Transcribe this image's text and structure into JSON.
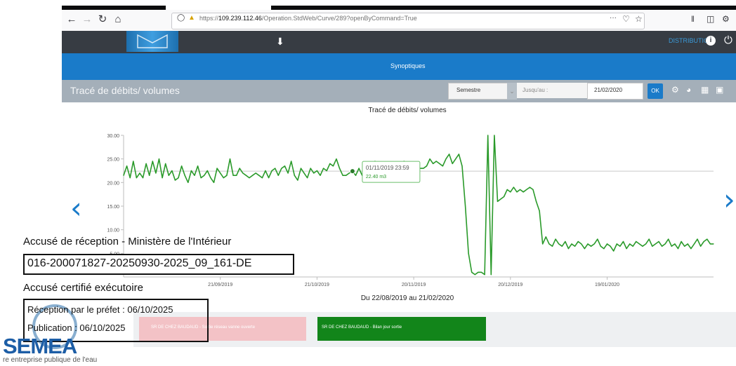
{
  "browser": {
    "url_prefix": "https://",
    "url_host": "109.239.112.46",
    "url_path": "/Operation.StdWeb/Curve/289?openByCommand=True",
    "menu_label": "···"
  },
  "header": {
    "distribution_label": "DISTRIBUTION"
  },
  "nav": {
    "synoptiques_label": "Synoptiques"
  },
  "toolbar": {
    "title": "Tracé de débits/ volumes",
    "period_value": "Semestre",
    "until_label": "Jusqu'au :",
    "date_value": "21/02/2020",
    "ok_label": "OK"
  },
  "chart": {
    "title": "Tracé de débits/ volumes",
    "period_label": "Du 22/08/2019 au 21/02/2020",
    "tooltip_date": "01/11/2019 23:59",
    "tooltip_value": "22.40 m3"
  },
  "chart_data": {
    "type": "line",
    "title": "Tracé de débits/ volumes",
    "xlabel": "Du 22/08/2019 au 21/02/2020",
    "ylabel": "",
    "x_range": [
      "2019-08-22",
      "2020-02-21"
    ],
    "ylim": [
      0,
      30
    ],
    "y_ticks": [
      5,
      10,
      15,
      20,
      25,
      30
    ],
    "y_tick_labels": [
      "5.00",
      "10.00",
      "15.00",
      "20.00",
      "25.00",
      "30.00"
    ],
    "x_tick_labels": [
      "21/09/2019",
      "21/10/2019",
      "20/11/2019",
      "20/12/2019",
      "19/01/2020"
    ],
    "x_tick_dates": [
      "2019-09-21",
      "2019-10-21",
      "2019-11-20",
      "2019-12-20",
      "2020-01-19"
    ],
    "grid": false,
    "reference_line": 22.4,
    "series": [
      {
        "color": "#2a9a2a",
        "points": [
          [
            "2019-08-22",
            21.5
          ],
          [
            "2019-08-23",
            23.5
          ],
          [
            "2019-08-24",
            21.0
          ],
          [
            "2019-08-25",
            24.5
          ],
          [
            "2019-08-26",
            21.0
          ],
          [
            "2019-08-27",
            22.0
          ],
          [
            "2019-08-28",
            21.0
          ],
          [
            "2019-08-29",
            24.0
          ],
          [
            "2019-08-30",
            21.5
          ],
          [
            "2019-08-31",
            24.5
          ],
          [
            "2019-09-01",
            22.0
          ],
          [
            "2019-09-02",
            25.0
          ],
          [
            "2019-09-03",
            21.0
          ],
          [
            "2019-09-04",
            24.0
          ],
          [
            "2019-09-05",
            21.5
          ],
          [
            "2019-09-06",
            22.5
          ],
          [
            "2019-09-07",
            20.5
          ],
          [
            "2019-09-08",
            21.0
          ],
          [
            "2019-09-09",
            23.5
          ],
          [
            "2019-09-10",
            21.5
          ],
          [
            "2019-09-11",
            20.0
          ],
          [
            "2019-09-12",
            22.5
          ],
          [
            "2019-09-13",
            21.5
          ],
          [
            "2019-09-14",
            23.5
          ],
          [
            "2019-09-15",
            21.0
          ],
          [
            "2019-09-16",
            21.5
          ],
          [
            "2019-09-17",
            22.5
          ],
          [
            "2019-09-18",
            21.0
          ],
          [
            "2019-09-19",
            20.0
          ],
          [
            "2019-09-20",
            23.0
          ],
          [
            "2019-09-21",
            22.0
          ],
          [
            "2019-09-22",
            21.0
          ],
          [
            "2019-09-23",
            21.5
          ],
          [
            "2019-09-24",
            25.0
          ],
          [
            "2019-09-25",
            21.5
          ],
          [
            "2019-09-26",
            21.5
          ],
          [
            "2019-09-27",
            23.0
          ],
          [
            "2019-09-28",
            22.0
          ],
          [
            "2019-09-29",
            21.5
          ],
          [
            "2019-09-30",
            21.0
          ],
          [
            "2019-10-01",
            21.5
          ],
          [
            "2019-10-02",
            22.0
          ],
          [
            "2019-10-03",
            21.5
          ],
          [
            "2019-10-04",
            21.0
          ],
          [
            "2019-10-05",
            22.5
          ],
          [
            "2019-10-06",
            21.0
          ],
          [
            "2019-10-07",
            22.5
          ],
          [
            "2019-10-08",
            23.0
          ],
          [
            "2019-10-09",
            21.5
          ],
          [
            "2019-10-10",
            23.0
          ],
          [
            "2019-10-11",
            23.5
          ],
          [
            "2019-10-12",
            22.0
          ],
          [
            "2019-10-13",
            24.5
          ],
          [
            "2019-10-14",
            21.5
          ],
          [
            "2019-10-15",
            20.5
          ],
          [
            "2019-10-16",
            23.0
          ],
          [
            "2019-10-17",
            22.0
          ],
          [
            "2019-10-18",
            21.0
          ],
          [
            "2019-10-19",
            23.0
          ],
          [
            "2019-10-20",
            22.0
          ],
          [
            "2019-10-21",
            22.5
          ],
          [
            "2019-10-22",
            21.5
          ],
          [
            "2019-10-23",
            23.0
          ],
          [
            "2019-10-24",
            22.5
          ],
          [
            "2019-10-25",
            24.0
          ],
          [
            "2019-10-26",
            23.5
          ],
          [
            "2019-10-27",
            25.0
          ],
          [
            "2019-10-28",
            23.0
          ],
          [
            "2019-10-29",
            21.5
          ],
          [
            "2019-10-30",
            21.5
          ],
          [
            "2019-10-31",
            22.0
          ],
          [
            "2019-11-01",
            22.4
          ],
          [
            "2019-11-02",
            21.5
          ],
          [
            "2019-11-03",
            23.0
          ],
          [
            "2019-11-04",
            21.5
          ],
          [
            "2019-11-05",
            22.0
          ],
          [
            "2019-11-06",
            21.5
          ],
          [
            "2019-11-07",
            23.5
          ],
          [
            "2019-11-08",
            24.5
          ],
          [
            "2019-11-09",
            22.0
          ],
          [
            "2019-11-10",
            23.5
          ],
          [
            "2019-11-11",
            22.0
          ],
          [
            "2019-11-12",
            23.5
          ],
          [
            "2019-11-13",
            24.0
          ],
          [
            "2019-11-14",
            22.5
          ],
          [
            "2019-11-15",
            22.0
          ],
          [
            "2019-11-16",
            23.0
          ],
          [
            "2019-11-17",
            24.5
          ],
          [
            "2019-11-18",
            23.5
          ],
          [
            "2019-11-19",
            23.0
          ],
          [
            "2019-11-20",
            22.5
          ],
          [
            "2019-11-21",
            23.0
          ],
          [
            "2019-11-22",
            23.0
          ],
          [
            "2019-11-23",
            23.0
          ],
          [
            "2019-11-24",
            23.5
          ],
          [
            "2019-11-25",
            25.0
          ],
          [
            "2019-11-26",
            24.0
          ],
          [
            "2019-11-27",
            24.5
          ],
          [
            "2019-11-28",
            24.0
          ],
          [
            "2019-11-29",
            23.5
          ],
          [
            "2019-11-30",
            25.0
          ],
          [
            "2019-12-01",
            26.0
          ],
          [
            "2019-12-02",
            24.0
          ],
          [
            "2019-12-03",
            25.0
          ],
          [
            "2019-12-04",
            26.0
          ],
          [
            "2019-12-05",
            23.5
          ],
          [
            "2019-12-06",
            15.0
          ],
          [
            "2019-12-07",
            5.0
          ],
          [
            "2019-12-08",
            1.0
          ],
          [
            "2019-12-09",
            0.5
          ],
          [
            "2019-12-10",
            1.0
          ],
          [
            "2019-12-11",
            1.0
          ],
          [
            "2019-12-12",
            0.5
          ],
          [
            "2019-12-13",
            30.0
          ],
          [
            "2019-12-14",
            0.5
          ],
          [
            "2019-12-15",
            30.0
          ],
          [
            "2019-12-16",
            16.0
          ],
          [
            "2019-12-17",
            16.5
          ],
          [
            "2019-12-18",
            17.0
          ],
          [
            "2019-12-19",
            18.5
          ],
          [
            "2019-12-20",
            18.0
          ],
          [
            "2019-12-21",
            19.0
          ],
          [
            "2019-12-22",
            18.0
          ],
          [
            "2019-12-23",
            18.5
          ],
          [
            "2019-12-24",
            18.0
          ],
          [
            "2019-12-25",
            18.5
          ],
          [
            "2019-12-26",
            19.0
          ],
          [
            "2019-12-27",
            18.5
          ],
          [
            "2019-12-28",
            16.0
          ],
          [
            "2019-12-29",
            14.0
          ],
          [
            "2019-12-30",
            7.0
          ],
          [
            "2019-12-31",
            8.5
          ],
          [
            "2020-01-01",
            7.0
          ],
          [
            "2020-01-02",
            6.5
          ],
          [
            "2020-01-03",
            8.0
          ],
          [
            "2020-01-04",
            7.0
          ],
          [
            "2020-01-05",
            6.5
          ],
          [
            "2020-01-06",
            7.5
          ],
          [
            "2020-01-07",
            6.0
          ],
          [
            "2020-01-08",
            7.0
          ],
          [
            "2020-01-09",
            6.5
          ],
          [
            "2020-01-10",
            7.5
          ],
          [
            "2020-01-11",
            7.0
          ],
          [
            "2020-01-12",
            6.0
          ],
          [
            "2020-01-13",
            7.0
          ],
          [
            "2020-01-14",
            6.5
          ],
          [
            "2020-01-15",
            7.0
          ],
          [
            "2020-01-16",
            8.0
          ],
          [
            "2020-01-17",
            6.5
          ],
          [
            "2020-01-18",
            6.0
          ],
          [
            "2020-01-19",
            7.0
          ],
          [
            "2020-01-20",
            6.5
          ],
          [
            "2020-01-21",
            5.5
          ],
          [
            "2020-01-22",
            7.0
          ],
          [
            "2020-01-23",
            6.5
          ],
          [
            "2020-01-24",
            7.5
          ],
          [
            "2020-01-25",
            6.0
          ],
          [
            "2020-01-26",
            7.0
          ],
          [
            "2020-01-27",
            6.5
          ],
          [
            "2020-01-28",
            7.5
          ],
          [
            "2020-01-29",
            7.0
          ],
          [
            "2020-01-30",
            6.5
          ],
          [
            "2020-01-31",
            7.0
          ],
          [
            "2020-02-01",
            8.0
          ],
          [
            "2020-02-02",
            6.5
          ],
          [
            "2020-02-03",
            7.0
          ],
          [
            "2020-02-04",
            7.5
          ],
          [
            "2020-02-05",
            6.5
          ],
          [
            "2020-02-06",
            7.0
          ],
          [
            "2020-02-07",
            8.0
          ],
          [
            "2020-02-08",
            6.5
          ],
          [
            "2020-02-09",
            7.0
          ],
          [
            "2020-02-10",
            6.0
          ],
          [
            "2020-02-11",
            7.5
          ],
          [
            "2020-02-12",
            6.5
          ],
          [
            "2020-02-13",
            7.0
          ],
          [
            "2020-02-14",
            6.0
          ],
          [
            "2020-02-15",
            7.0
          ],
          [
            "2020-02-16",
            8.0
          ],
          [
            "2020-02-17",
            6.5
          ],
          [
            "2020-02-18",
            7.5
          ],
          [
            "2020-02-19",
            8.0
          ],
          [
            "2020-02-20",
            7.0
          ],
          [
            "2020-02-21",
            7.0
          ]
        ]
      }
    ],
    "tooltip": {
      "date": "2019-11-01",
      "value": 22.4
    }
  },
  "cards": {
    "red_label": "SR DE CHEZ BAUDAUD - Sortie réseau vanne ouverte",
    "green_label": "SR DE CHEZ BAUDAUD - Bilan jour sortie"
  },
  "stamp": {
    "line1": "Accusé de réception - Ministère de l'Intérieur",
    "reference": "016-200071827-20250930-2025_09_161-DE",
    "line3": "Accusé certifié exécutoire",
    "reception": "Réception par le préfet : 06/10/2025",
    "publication": "Publication : 06/10/2025"
  },
  "logo": {
    "name": "SEMEA",
    "tagline": "re entreprise publique de l'eau"
  },
  "colors": {
    "header_dark": "#373c43",
    "nav_blue": "#1a7bc9",
    "title_bar_grey": "#a4afb9",
    "series_green": "#2a9a2a",
    "card_green": "#12851a",
    "card_red": "#f3c2c6"
  },
  "icons": {
    "download": "download-icon",
    "info": "info-icon",
    "power": "power-icon",
    "settings": "gear-icon",
    "pie": "pie-chart-icon",
    "table": "table-icon",
    "image": "image-icon"
  }
}
